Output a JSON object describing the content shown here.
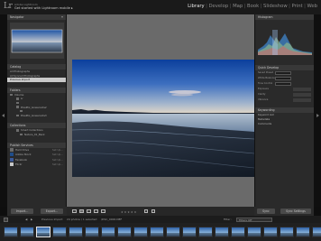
{
  "app": {
    "logo": "Lr",
    "identity_line1": "Adobe Lightroom",
    "identity_line2": "Get started with Lightroom mobile ▸"
  },
  "modules": [
    "Library",
    "Develop",
    "Map",
    "Book",
    "Slideshow",
    "Print",
    "Web"
  ],
  "active_module": "Library",
  "left_panel": {
    "navigator_label": "Navigator",
    "catalog_label": "Catalog",
    "catalog_items": [
      {
        "label": "All Photographs",
        "count": "",
        "selected": false
      },
      {
        "label": "All Synced Photographs",
        "count": "",
        "selected": false
      },
      {
        "label": "Previous Import",
        "count": "",
        "selected": true
      }
    ],
    "folders_label": "Folders",
    "folder_items": [
      {
        "label": "Volume",
        "count": "",
        "indent": 0
      },
      {
        "label": "Lr",
        "count": "",
        "indent": 1
      },
      {
        "label": "",
        "count": "",
        "indent": 1
      },
      {
        "label": "PixelPix_Grassroots2",
        "count": "",
        "indent": 1
      },
      {
        "label": "",
        "count": "",
        "indent": 2
      },
      {
        "label": "PixelPix_Grassroots3",
        "count": "",
        "indent": 1
      }
    ],
    "collections_label": "Collections",
    "collection_items": [
      {
        "label": "Smart Collections",
        "indent": 0
      },
      {
        "label": "Nature_01_Back",
        "indent": 1
      }
    ],
    "publish_label": "Publish Services",
    "publish_items": [
      {
        "label": "Hard Drive",
        "setup": "Set Up...",
        "color": "#6a6a6a"
      },
      {
        "label": "Adobe Stock",
        "setup": "Set Up...",
        "color": "#1f4d8a"
      },
      {
        "label": "Facebook",
        "setup": "Set Up...",
        "color": "#3b5998"
      },
      {
        "label": "Flickr",
        "setup": "Set Up...",
        "color": "#c8c8c8"
      }
    ],
    "import_button": "Import...",
    "export_button": "Export..."
  },
  "right_panel": {
    "histogram_label": "Histogram",
    "histogram_info": "",
    "quick_develop_label": "Quick Develop",
    "quick_develop_rows": [
      "Saved Preset",
      "White Balance",
      "Tone Control",
      "Exposure",
      "Clarity",
      "Vibrance"
    ],
    "keywording_label": "Keywording",
    "keyword_list_label": "Keyword List",
    "metadata_label": "Metadata",
    "comments_label": "Comments",
    "sync_button": "Sync",
    "sync_settings_button": "Sync Settings"
  },
  "toolbar": {
    "stars": "★ ★ ★ ★ ★"
  },
  "filmbar": {
    "source_label": "Previous Import",
    "photo_count": "24 photos / 1 selected",
    "filename": "/DSC_0000.NEF",
    "filter_label": "Filter :",
    "filters_off": "Filters Off"
  },
  "filmstrip": {
    "thumbnail_count": 20,
    "selected_index": 2
  },
  "colors": {
    "accent_selected": "#c9c9c9",
    "panel": "#2a2a2a",
    "canvas": "#6a6a6a"
  }
}
